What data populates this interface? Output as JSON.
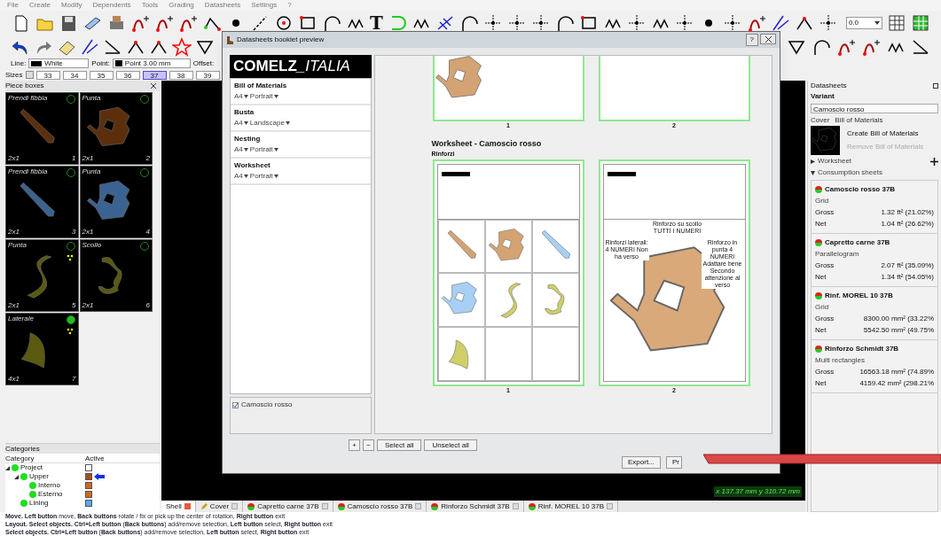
{
  "menu": [
    "File",
    "Create",
    "Modify",
    "Dependents",
    "Tools",
    "Grading",
    "Datasheets",
    "Settings",
    "?"
  ],
  "toolbar": {
    "text_tool": "T",
    "zoom_value": "0.0"
  },
  "properties": {
    "line_label": "Line:",
    "line_value": "White",
    "point_label": "Point:",
    "point_value": "Point 3.00 mm",
    "offset_label": "Offset:"
  },
  "sizes": {
    "label": "Sizes",
    "items": [
      {
        "label": "33",
        "selected": false
      },
      {
        "label": "34",
        "selected": false
      },
      {
        "label": "35",
        "selected": false
      },
      {
        "label": "36",
        "selected": false
      },
      {
        "label": "37",
        "selected": true
      },
      {
        "label": "38",
        "selected": false
      },
      {
        "label": "39",
        "selected": false
      }
    ]
  },
  "piece_boxes": {
    "title": "Piece boxes",
    "pieces": [
      {
        "name": "Prendi fibbia",
        "count": "2x1",
        "number": "1",
        "kind": "strap",
        "color": "#5c2f0c",
        "active": false,
        "marked": false
      },
      {
        "name": "Punta",
        "count": "2x1",
        "number": "2",
        "kind": "toe",
        "color": "#5c2f0c",
        "active": false,
        "marked": false
      },
      {
        "name": "Prendi fibbia",
        "count": "2x1",
        "number": "3",
        "kind": "strap",
        "color": "#3b6391",
        "active": false,
        "marked": false
      },
      {
        "name": "Punta",
        "count": "2x1",
        "number": "4",
        "kind": "toe",
        "color": "#3b6391",
        "active": false,
        "marked": false
      },
      {
        "name": "Punta",
        "count": "2x1",
        "number": "5",
        "kind": "wave",
        "color": "#5a5a10",
        "active": false,
        "marked": true
      },
      {
        "name": "Scollo",
        "count": "2x1",
        "number": "6",
        "kind": "arc",
        "color": "#5a5a10",
        "active": false,
        "marked": false
      },
      {
        "name": "Laterale",
        "count": "4x1",
        "number": "7",
        "kind": "panel",
        "color": "#5a5a10",
        "active": true,
        "marked": true
      }
    ]
  },
  "categories": {
    "title": "Categories",
    "columns": [
      "Category",
      "Active"
    ],
    "tree": [
      {
        "name": "Project",
        "color": "#ffffff",
        "current": false,
        "children": [
          {
            "name": "Upper",
            "color": "#a8501a",
            "current": true,
            "children": [
              {
                "name": "Interno",
                "color": "#d0681a",
                "current": false
              },
              {
                "name": "Esterno",
                "color": "#d0681a",
                "current": false
              }
            ]
          },
          {
            "name": "Lining",
            "color": "#58a8f0",
            "current": false
          }
        ]
      }
    ]
  },
  "canvas": {
    "coordinates": "x 137.37 mm  y 310.72 mm"
  },
  "tabs": [
    {
      "label": "Shell",
      "kind": "shell",
      "selected": true
    },
    {
      "label": "Cover",
      "kind": "cover",
      "selected": false
    },
    {
      "label": "Capretto carne 37B",
      "kind": "sheet",
      "selected": false
    },
    {
      "label": "Camoscio rosso 37B",
      "kind": "sheet",
      "selected": false
    },
    {
      "label": "Rinforzo Schmidt 37B",
      "kind": "sheet",
      "selected": false
    },
    {
      "label": "Rinf. MOREL 10 37B",
      "kind": "sheet",
      "selected": false
    }
  ],
  "status_lines": [
    "**Move.** **Left button** move, **Back buttons** rotate / fix or pick up the center of rotation, **Right button** exit",
    "**Layout.** **Select objects.** **Ctrl+Left button** (**Back buttons**) add/remove selection, **Left button** select, **Right button** exit",
    "**Select objects.** **Ctrl+Left button** (**Back buttons**) add/remove selection, **Left button** select, **Right button** exit"
  ],
  "datasheets": {
    "title": "Datasheets",
    "variant_label": "Variant",
    "variant_value": "Camoscio rosso",
    "cover_label": "Cover",
    "bom_label": "Bill of Materials",
    "create_bom": "Create Bill of Materials",
    "remove_bom": "Remove Bill of Materials",
    "remove_disabled": true,
    "sections": [
      {
        "label": "Worksheet",
        "expanded": false
      },
      {
        "label": "Consumption sheets",
        "expanded": true
      }
    ],
    "sheets": [
      {
        "name": "Camoscio rosso 37B",
        "method": "Grid",
        "gross_label": "Gross",
        "gross": "1.32 ft² (21.02%)",
        "net_label": "Net",
        "net": "1.04 ft² (26.62%)"
      },
      {
        "name": "Capretto carne 37B",
        "method": "Parallelogram",
        "gross_label": "Gross",
        "gross": "2.07 ft² (35.09%)",
        "net_label": "Net",
        "net": "1.34 ft² (54.05%)"
      },
      {
        "name": "Rinf. MOREL 10 37B",
        "method": "Grid",
        "gross_label": "Gross",
        "gross": "8300.00 mm² (33.22%",
        "net_label": "Net",
        "net": "5542.50 mm² (49.75%"
      },
      {
        "name": "Rinforzo Schmidt 37B",
        "method": "Multi rectangles",
        "gross_label": "Gross",
        "gross": "16563.18 mm² (74.89%",
        "net_label": "Net",
        "net": "4159.42 mm² (298.21%"
      }
    ]
  },
  "dialog": {
    "title": "Datasheets booklet preview",
    "help": "?",
    "logo_bold": "COMELZ",
    "logo_light": "_ITALIA",
    "booklet": [
      {
        "name": "Bill of Materials",
        "paper": "A4",
        "orientation": "Portrait"
      },
      {
        "name": "Busta",
        "paper": "A4",
        "orientation": "Landscape"
      },
      {
        "name": "Nesting",
        "paper": "A4",
        "orientation": "Portrait"
      },
      {
        "name": "Worksheet",
        "paper": "A4",
        "orientation": "Portrait"
      }
    ],
    "variants": [
      {
        "label": "Camoscio rosso",
        "checked": true
      }
    ],
    "list_buttons": [
      "+",
      "−",
      "Select all",
      "Unselect all"
    ],
    "top_pages": [
      "1",
      "2"
    ],
    "heading": "Worksheet - Camoscio rosso",
    "subheading": "Rinforzi",
    "pages": [
      "1",
      "2"
    ],
    "notes": [
      "Rinforzi laterali: 4 NUMERI Non ha verso",
      "Rinforzo su scollo TUTTI I NUMERI",
      "Rinforzo in punta 4 NUMERI Adattare bene Secondo attenzione al verso"
    ],
    "buttons": [
      "Export...",
      "Pr"
    ]
  }
}
